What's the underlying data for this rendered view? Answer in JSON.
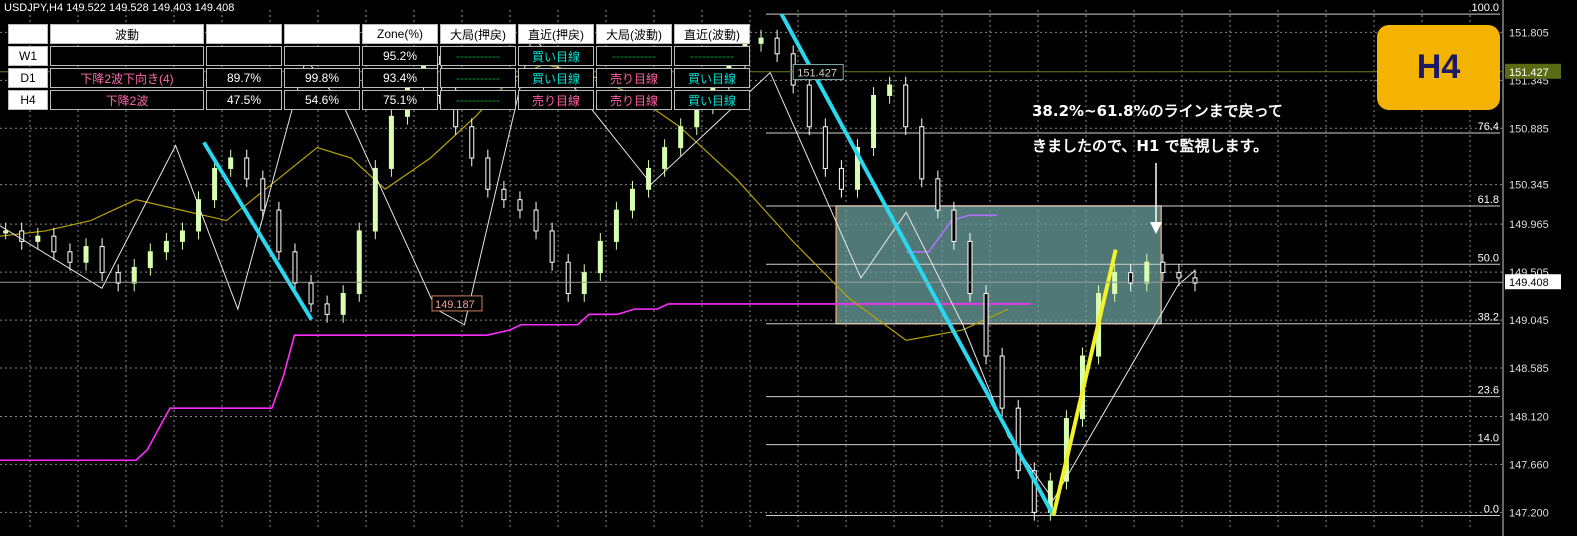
{
  "header": {
    "symbol_line": "USDJPY,H4  149.522 149.528 149.403 149.408"
  },
  "info_table": {
    "headers": [
      "",
      "波動",
      "",
      "",
      "Zone(%)",
      "大局(押戻)",
      "直近(押戻)",
      "大局(波動)",
      "直近(波動)"
    ],
    "rows": [
      {
        "label": "W1",
        "wave": "",
        "p1": "",
        "p2": "",
        "zone": "95.2%",
        "big_pull": "-----------",
        "near_pull": "買い目線",
        "big_wave": "-----------",
        "near_wave": "-----------"
      },
      {
        "label": "D1",
        "wave": "下降2波下向き(4)",
        "p1": "89.7%",
        "p2": "99.8%",
        "zone": "93.4%",
        "big_pull": "-----------",
        "near_pull": "買い目線",
        "big_wave": "売り目線",
        "near_wave": "買い目線"
      },
      {
        "label": "H4",
        "wave": "下降2波",
        "p1": "47.5%",
        "p2": "54.6%",
        "zone": "75.1%",
        "big_pull": "-----------",
        "near_pull": "売り目線",
        "big_wave": "売り目線",
        "near_wave": "買い目線"
      }
    ],
    "colors": {
      "buy": "#00e0d0",
      "sell": "#ff5fa0",
      "dash": "#00a040",
      "wave": "#ff6aa8"
    }
  },
  "badge": {
    "label": "H4"
  },
  "annotation": {
    "line1": "38.2%~61.8%のラインまで戻って",
    "line2": "きましたので、H1 で監視します。"
  },
  "chart_data": {
    "type": "line",
    "price_axis": {
      "ticks": [
        "151.805",
        "151.345",
        "150.885",
        "150.345",
        "149.965",
        "149.505",
        "149.045",
        "148.585",
        "148.120",
        "147.660",
        "147.200"
      ],
      "current_price": "149.408",
      "marker_price": "151.427"
    },
    "fib_levels": [
      {
        "label": "100.0",
        "price": 151.98
      },
      {
        "label": "76.4",
        "price": 150.84
      },
      {
        "label": "61.8",
        "price": 150.14
      },
      {
        "label": "50.0",
        "price": 149.58
      },
      {
        "label": "38.2",
        "price": 149.01
      },
      {
        "label": "23.6",
        "price": 148.31
      },
      {
        "label": "14.0",
        "price": 147.85
      },
      {
        "label": "0.0",
        "price": 147.17
      }
    ],
    "price_labels": [
      "151.427",
      "149.187"
    ],
    "zigzag_x": [
      0,
      18,
      31,
      42,
      54,
      61,
      77,
      82,
      94,
      115,
      136,
      152,
      160,
      170,
      178,
      186,
      208,
      211
    ],
    "zigzag_y": [
      149.95,
      149.35,
      150.72,
      149.15,
      151.55,
      151.06,
      149.15,
      149.0,
      151.78,
      150.35,
      151.42,
      149.45,
      150.08,
      149.0,
      147.93,
      147.32,
      149.38,
      149.52
    ],
    "candle_close": [
      149.9,
      149.8,
      149.85,
      149.7,
      149.6,
      149.75,
      149.5,
      149.4,
      149.55,
      149.7,
      149.8,
      149.9,
      150.2,
      150.5,
      150.6,
      150.4,
      150.1,
      149.7,
      149.4,
      149.2,
      149.1,
      149.3,
      149.9,
      150.5,
      151.0,
      151.3,
      151.5,
      151.2,
      150.9,
      150.6,
      150.3,
      150.2,
      150.1,
      149.9,
      149.6,
      149.3,
      149.5,
      149.8,
      150.1,
      150.3,
      150.5,
      150.7,
      150.9,
      151.1,
      151.3,
      151.5,
      151.7,
      151.75,
      151.6,
      151.3,
      150.9,
      150.5,
      150.3,
      150.7,
      151.2,
      151.3,
      150.9,
      150.4,
      150.1,
      149.8,
      149.3,
      148.7,
      148.2,
      147.6,
      147.2,
      147.5,
      148.1,
      148.7,
      149.3,
      149.5,
      149.4,
      149.6,
      149.5,
      149.45,
      149.4
    ],
    "ma_y": [
      149.85,
      149.9,
      150.0,
      150.2,
      150.1,
      150.0,
      150.35,
      150.7,
      150.6,
      150.3,
      150.6,
      151.0,
      151.35,
      151.5,
      151.4,
      151.2,
      150.9,
      150.4,
      149.8,
      149.25,
      148.85,
      148.95,
      149.15
    ],
    "ma_x": [
      0,
      8,
      16,
      24,
      32,
      40,
      48,
      56,
      62,
      68,
      76,
      84,
      90,
      96,
      104,
      112,
      120,
      130,
      140,
      150,
      160,
      170,
      178
    ],
    "step_x": [
      0,
      24,
      26,
      28,
      30,
      48,
      50,
      52,
      86,
      90,
      92,
      102,
      104,
      109,
      112,
      116,
      118,
      182
    ],
    "step_y": [
      147.7,
      147.7,
      147.8,
      148.0,
      148.2,
      148.2,
      148.5,
      148.9,
      148.9,
      148.95,
      149.0,
      149.0,
      149.1,
      149.1,
      149.15,
      149.15,
      149.2,
      149.2
    ],
    "purple_x": [
      160,
      164,
      166,
      168,
      171,
      176
    ],
    "purple_y": [
      149.7,
      149.7,
      149.85,
      150.0,
      150.05,
      150.05
    ],
    "current_price": 149.408,
    "marker_price": 151.427,
    "zone": {
      "top": 150.14,
      "bottom": 149.01
    },
    "colors": {
      "up": "#d8ffb0",
      "down": "#ffffff",
      "cyan": "#29d7ee",
      "yellow": "#f2f22a",
      "ma": "#b8a400",
      "magenta": "#ff2cff",
      "purple": "#b070ff",
      "zone": "#6ea6a4",
      "grid": "#888888"
    }
  }
}
